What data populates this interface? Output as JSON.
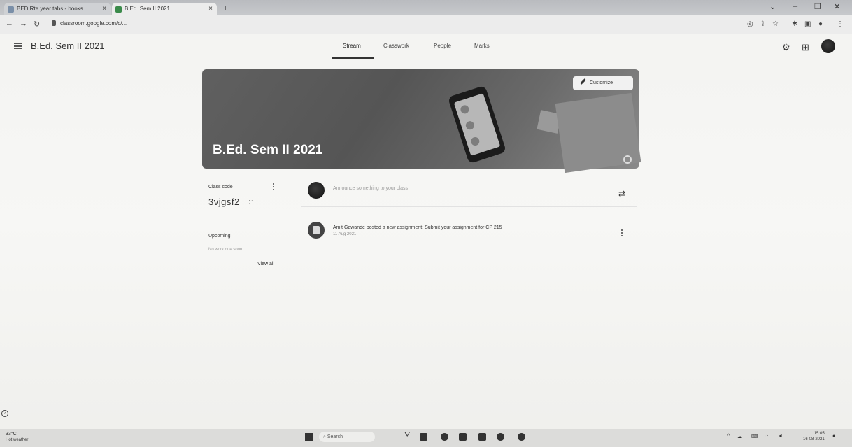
{
  "browser": {
    "tabs": [
      {
        "label": "BED Rte year tabs - books"
      },
      {
        "label": "B.Ed. Sem II 2021"
      }
    ],
    "url": "classroom.google.com/c/..."
  },
  "app": {
    "title": "B.Ed. Sem II 2021",
    "nav_tabs": [
      "Stream",
      "Classwork",
      "People",
      "Marks"
    ]
  },
  "banner": {
    "title": "B.Ed. Sem II 2021",
    "customize_label": "Customize"
  },
  "sidebar": {
    "class_code_label": "Class code",
    "class_code": "3vjgsf2",
    "upcoming_label": "Upcoming",
    "upcoming_text": "No work due soon",
    "view_all_label": "View all"
  },
  "stream": {
    "announce_placeholder": "Announce something to your class",
    "posts": [
      {
        "text": "Amit Gawande posted a new assignment: Submit your assignment for CP 215",
        "date": "11 Aug 2021"
      }
    ]
  },
  "taskbar": {
    "weather_temp": "33°C",
    "weather_desc": "Hot weather",
    "search_label": "Search",
    "clock_time": "15:05",
    "clock_date": "16-08-2021"
  }
}
